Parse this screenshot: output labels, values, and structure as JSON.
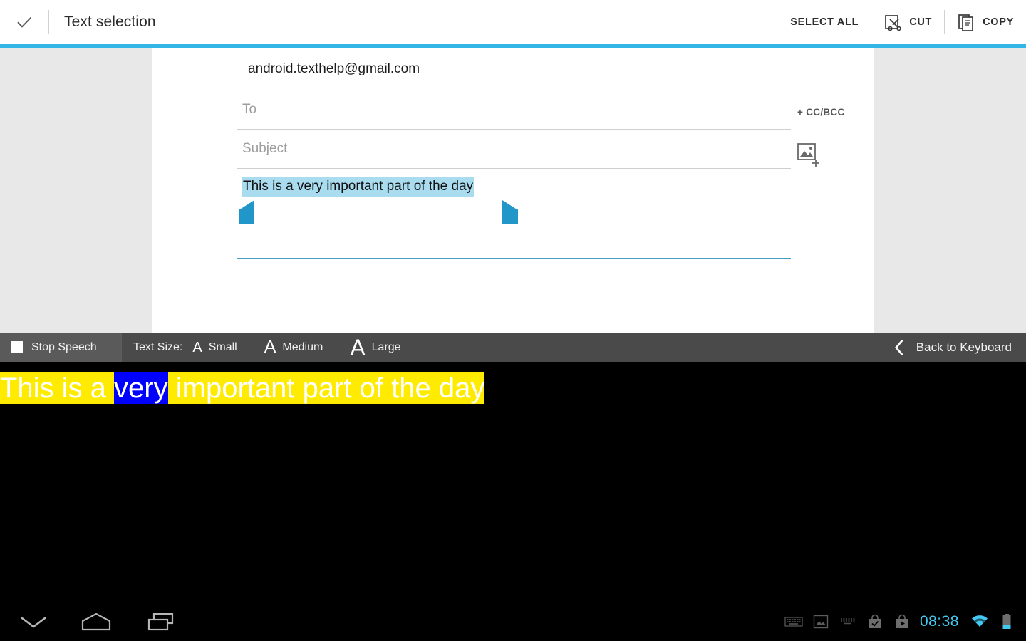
{
  "action_bar": {
    "done_icon": "check-icon",
    "title": "Text selection",
    "actions": [
      {
        "label": "SELECT ALL",
        "icon": null
      },
      {
        "label": "CUT",
        "icon": "scissors-cut-icon"
      },
      {
        "label": "COPY",
        "icon": "copy-pages-icon"
      }
    ],
    "accent_color": "#33b5e5"
  },
  "compose": {
    "from_value": "android.texthelp@gmail.com",
    "to_placeholder": "To",
    "subject_placeholder": "Subject",
    "cc_bcc_label": "+ CC/BCC",
    "attach_icon": "add-image-icon",
    "body_text": "This is a very important part of the day",
    "selection_highlight_color": "#aadcf0",
    "handle_color": "#2196c8"
  },
  "speech_bar": {
    "stop_label": "Stop Speech",
    "stop_icon": "stop-square-icon",
    "text_size_label": "Text Size:",
    "sizes": [
      {
        "glyph": "A",
        "label": "Small"
      },
      {
        "glyph": "A",
        "label": "Medium"
      },
      {
        "glyph": "A",
        "label": "Large"
      }
    ],
    "back_icon": "chevron-left-icon",
    "back_label": "Back to Keyboard",
    "background_color": "#4a4a4a"
  },
  "karaoke": {
    "segments": [
      {
        "text": "This is a ",
        "active": false
      },
      {
        "text": "very",
        "active": true
      },
      {
        "text": " important part of the day",
        "active": false
      }
    ],
    "highlight_color": "#ffeb00",
    "active_color": "#0000ff",
    "text_color": "#ffffff",
    "background_color": "#000000"
  },
  "navbar": {
    "back_icon": "hide-keyboard-chevron-icon",
    "home_icon": "home-icon",
    "recents_icon": "recents-icon",
    "status_icons": [
      "keyboard-icon",
      "screenshot-image-icon",
      "keyboard-alt-icon",
      "bag-check-icon",
      "bag-play-icon"
    ],
    "clock": "08:38",
    "wifi_icon": "wifi-icon",
    "battery_icon": "battery-icon",
    "accent_color": "#44c8f0"
  }
}
